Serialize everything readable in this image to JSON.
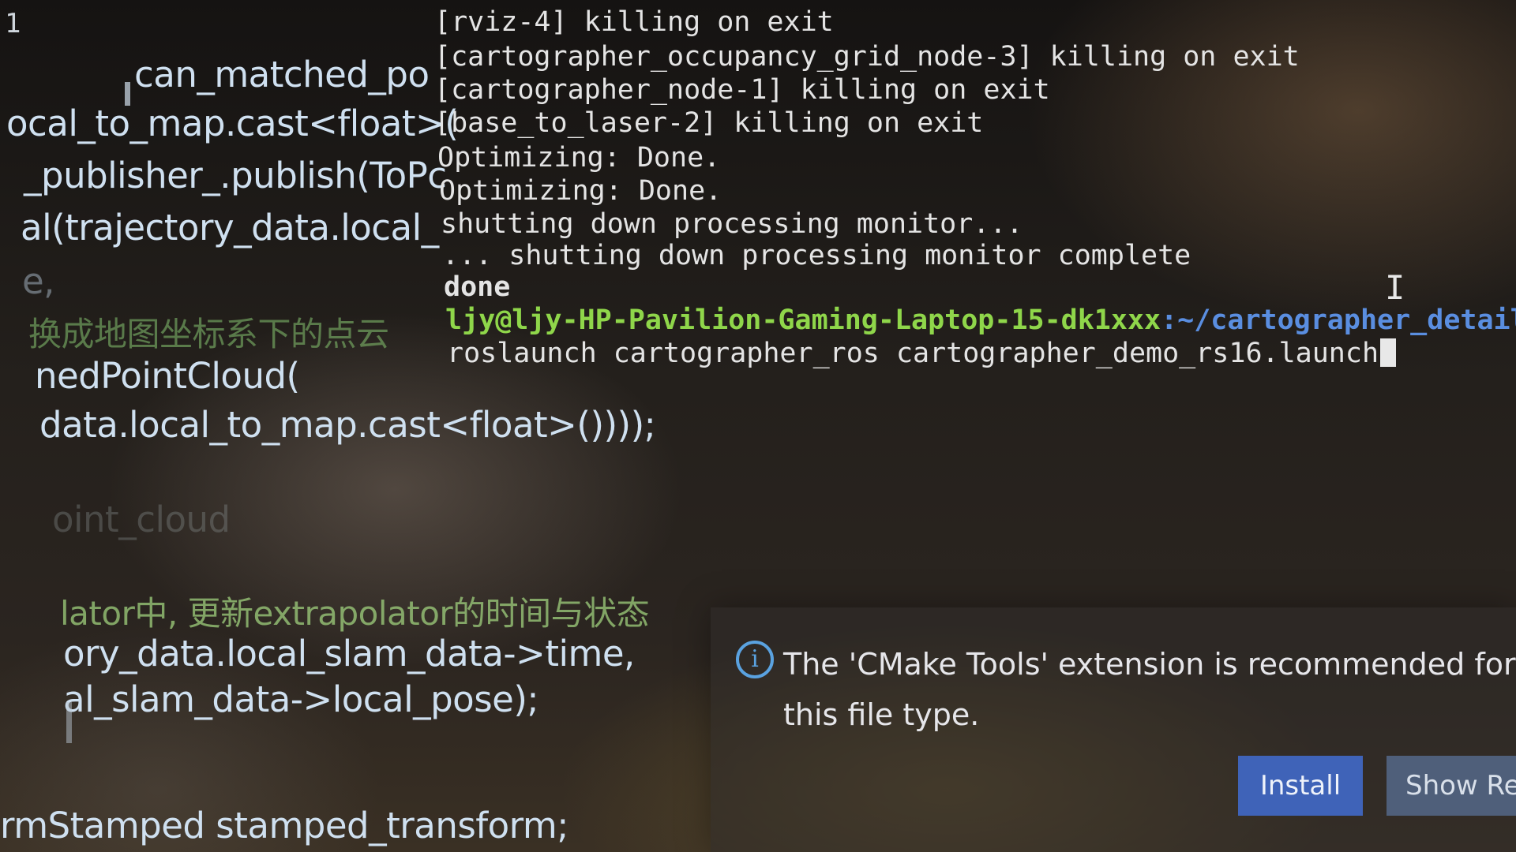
{
  "editor": {
    "line_number": "1",
    "lines": [
      "can_matched_po",
      "ocal_to_map.cast<float>(",
      "_publisher_.publish(ToPc",
      "al(trajectory_data.local_",
      "e,",
      "换成地图坐标系下的点云",
      "nedPointCloud(",
      "data.local_to_map.cast<float>())));",
      "oint_cloud",
      "lator中, 更新extrapolator的时间与状态",
      "ory_data.local_slam_data->time,",
      "al_slam_data->local_pose);",
      "rmStamped stamped_transform;"
    ]
  },
  "terminal": {
    "lines": [
      "[rviz-4] killing on exit",
      "[cartographer_occupancy_grid_node-3] killing on exit",
      "[cartographer_node-1] killing on exit",
      "[base_to_laser-2] killing on exit",
      "Optimizing: Done.",
      "Optimizing: Done.",
      "shutting down processing monitor...",
      "... shutting down processing monitor complete",
      "done"
    ],
    "prompt_user": "ljy@ljy-HP-Pavilion-Gaming-Laptop-15-dk1xxx",
    "prompt_path": ":~/cartographer_detailed_",
    "command": " roslaunch cartographer_ros cartographer_demo_rs16.launch"
  },
  "notification": {
    "icon": "info-icon",
    "message": "The 'CMake Tools' extension is recommended for this file type.",
    "install_label": "Install",
    "show_label": "Show Re"
  },
  "colors": {
    "prompt_user": "#8fd64a",
    "prompt_path": "#5a8ee0",
    "install_button": "#3f63b8",
    "info_icon": "#5aa2e0"
  }
}
